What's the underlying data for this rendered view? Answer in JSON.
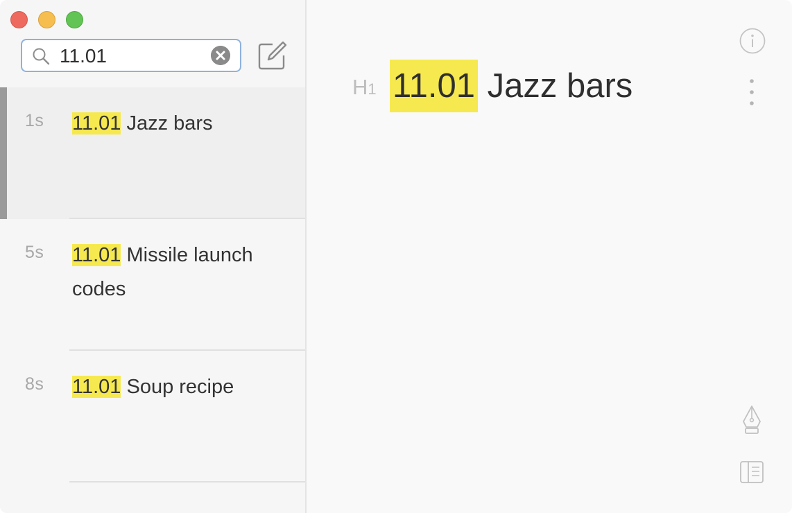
{
  "window": {
    "controls": [
      "close",
      "minimize",
      "zoom"
    ],
    "colors": {
      "close": "#ee6a5e",
      "minimize": "#f5be4f",
      "zoom": "#61c454",
      "highlight": "#f6e94f",
      "search_border": "#8eb2dd"
    }
  },
  "search": {
    "value": "11.01",
    "icon": "magnifying-glass-icon",
    "clear_icon": "clear-circle-icon"
  },
  "toolbar": {
    "compose_icon": "compose-icon"
  },
  "notes": [
    {
      "age": "1s",
      "match": "11.01",
      "rest": " Jazz bars",
      "selected": true
    },
    {
      "age": "5s",
      "match": "11.01",
      "rest": " Missile launch codes",
      "selected": false
    },
    {
      "age": "8s",
      "match": "11.01",
      "rest": " Soup recipe",
      "selected": false
    }
  ],
  "editor": {
    "heading_marker": "H",
    "heading_level": "1",
    "title_match": "11.01",
    "title_rest": " Jazz bars",
    "icons": [
      "info-icon",
      "more-vertical-icon",
      "pen-nib-icon",
      "sidebar-panel-icon"
    ]
  }
}
